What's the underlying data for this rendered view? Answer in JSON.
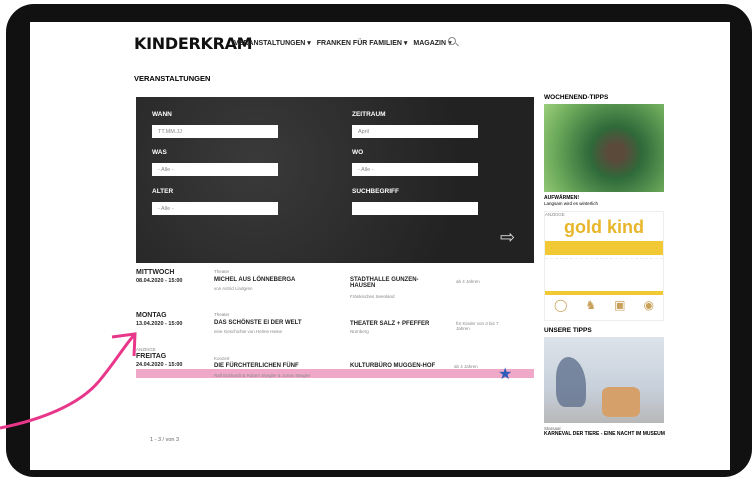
{
  "logo": "KINDERKRAM",
  "nav": [
    "VERANSTALTUNGEN ▾",
    "FRANKEN FÜR FAMILIEN ▾",
    "MAGAZIN ▾"
  ],
  "page_title": "VERANSTALTUNGEN",
  "filter": {
    "wann_label": "WANN",
    "wann_placeholder": "TT.MM.JJ",
    "zeitraum_label": "ZEITRAUM",
    "zeitraum_value": "April",
    "was_label": "WAS",
    "was_value": "- Alle -",
    "wo_label": "WO",
    "wo_value": "- Alle -",
    "alter_label": "ALTER",
    "alter_value": "- Alle -",
    "suchbegriff_label": "SUCHBEGRIFF",
    "suchbegriff_value": ""
  },
  "events": [
    {
      "day": "MITTWOCH",
      "date": "08.04.2020 - 15:00",
      "category": "Theater",
      "title": "MICHEL AUS LÖNNEBERGA",
      "subtitle": "von Astrid Lindgren",
      "venue": "STADTHALLE GUNZEN-HAUSEN",
      "venue_sub": "Fränkisches Seenland",
      "age": "ab 4 Jahren"
    },
    {
      "day": "MONTAG",
      "date": "13.04.2020 - 15:00",
      "category": "Theater",
      "title": "DAS SCHÖNSTE EI DER WELT",
      "subtitle": "eine Geschichte von Helme Heine",
      "venue": "THEATER SALZ + PFEFFER",
      "venue_sub": "Nürnberg",
      "age": "für Kinder von 3 bis 7 Jahren"
    },
    {
      "tag": "ANZEIGE",
      "day": "FREITAG",
      "date": "24.04.2020 - 15:00",
      "category": "Konzert",
      "title": "DIE FÜRCHTERLICHEN FÜNF",
      "subtitle": "Ralf Eckhardt & Robert Stiegler & Jonas Stiegler",
      "venue": "KULTURBÜRO MUGGEN-HOF",
      "age": "ab 4 Jahren"
    }
  ],
  "pagination": "1 - 3 / von 3",
  "sidebar": {
    "weekend_title": "WOCHENEND-TIPPS",
    "weekend_caption": "AUFWÄRMEN!",
    "weekend_sub": "Langsam wird es winterlich",
    "ad_tag": "ANZEIGE",
    "ad_brand": "gold kind",
    "tips_title": "UNSERE TIPPS",
    "tip_cat": "Starsaal",
    "tip_caption": "KARNEVAL DER TIERE - EINE NACHT IM MUSEUM"
  }
}
